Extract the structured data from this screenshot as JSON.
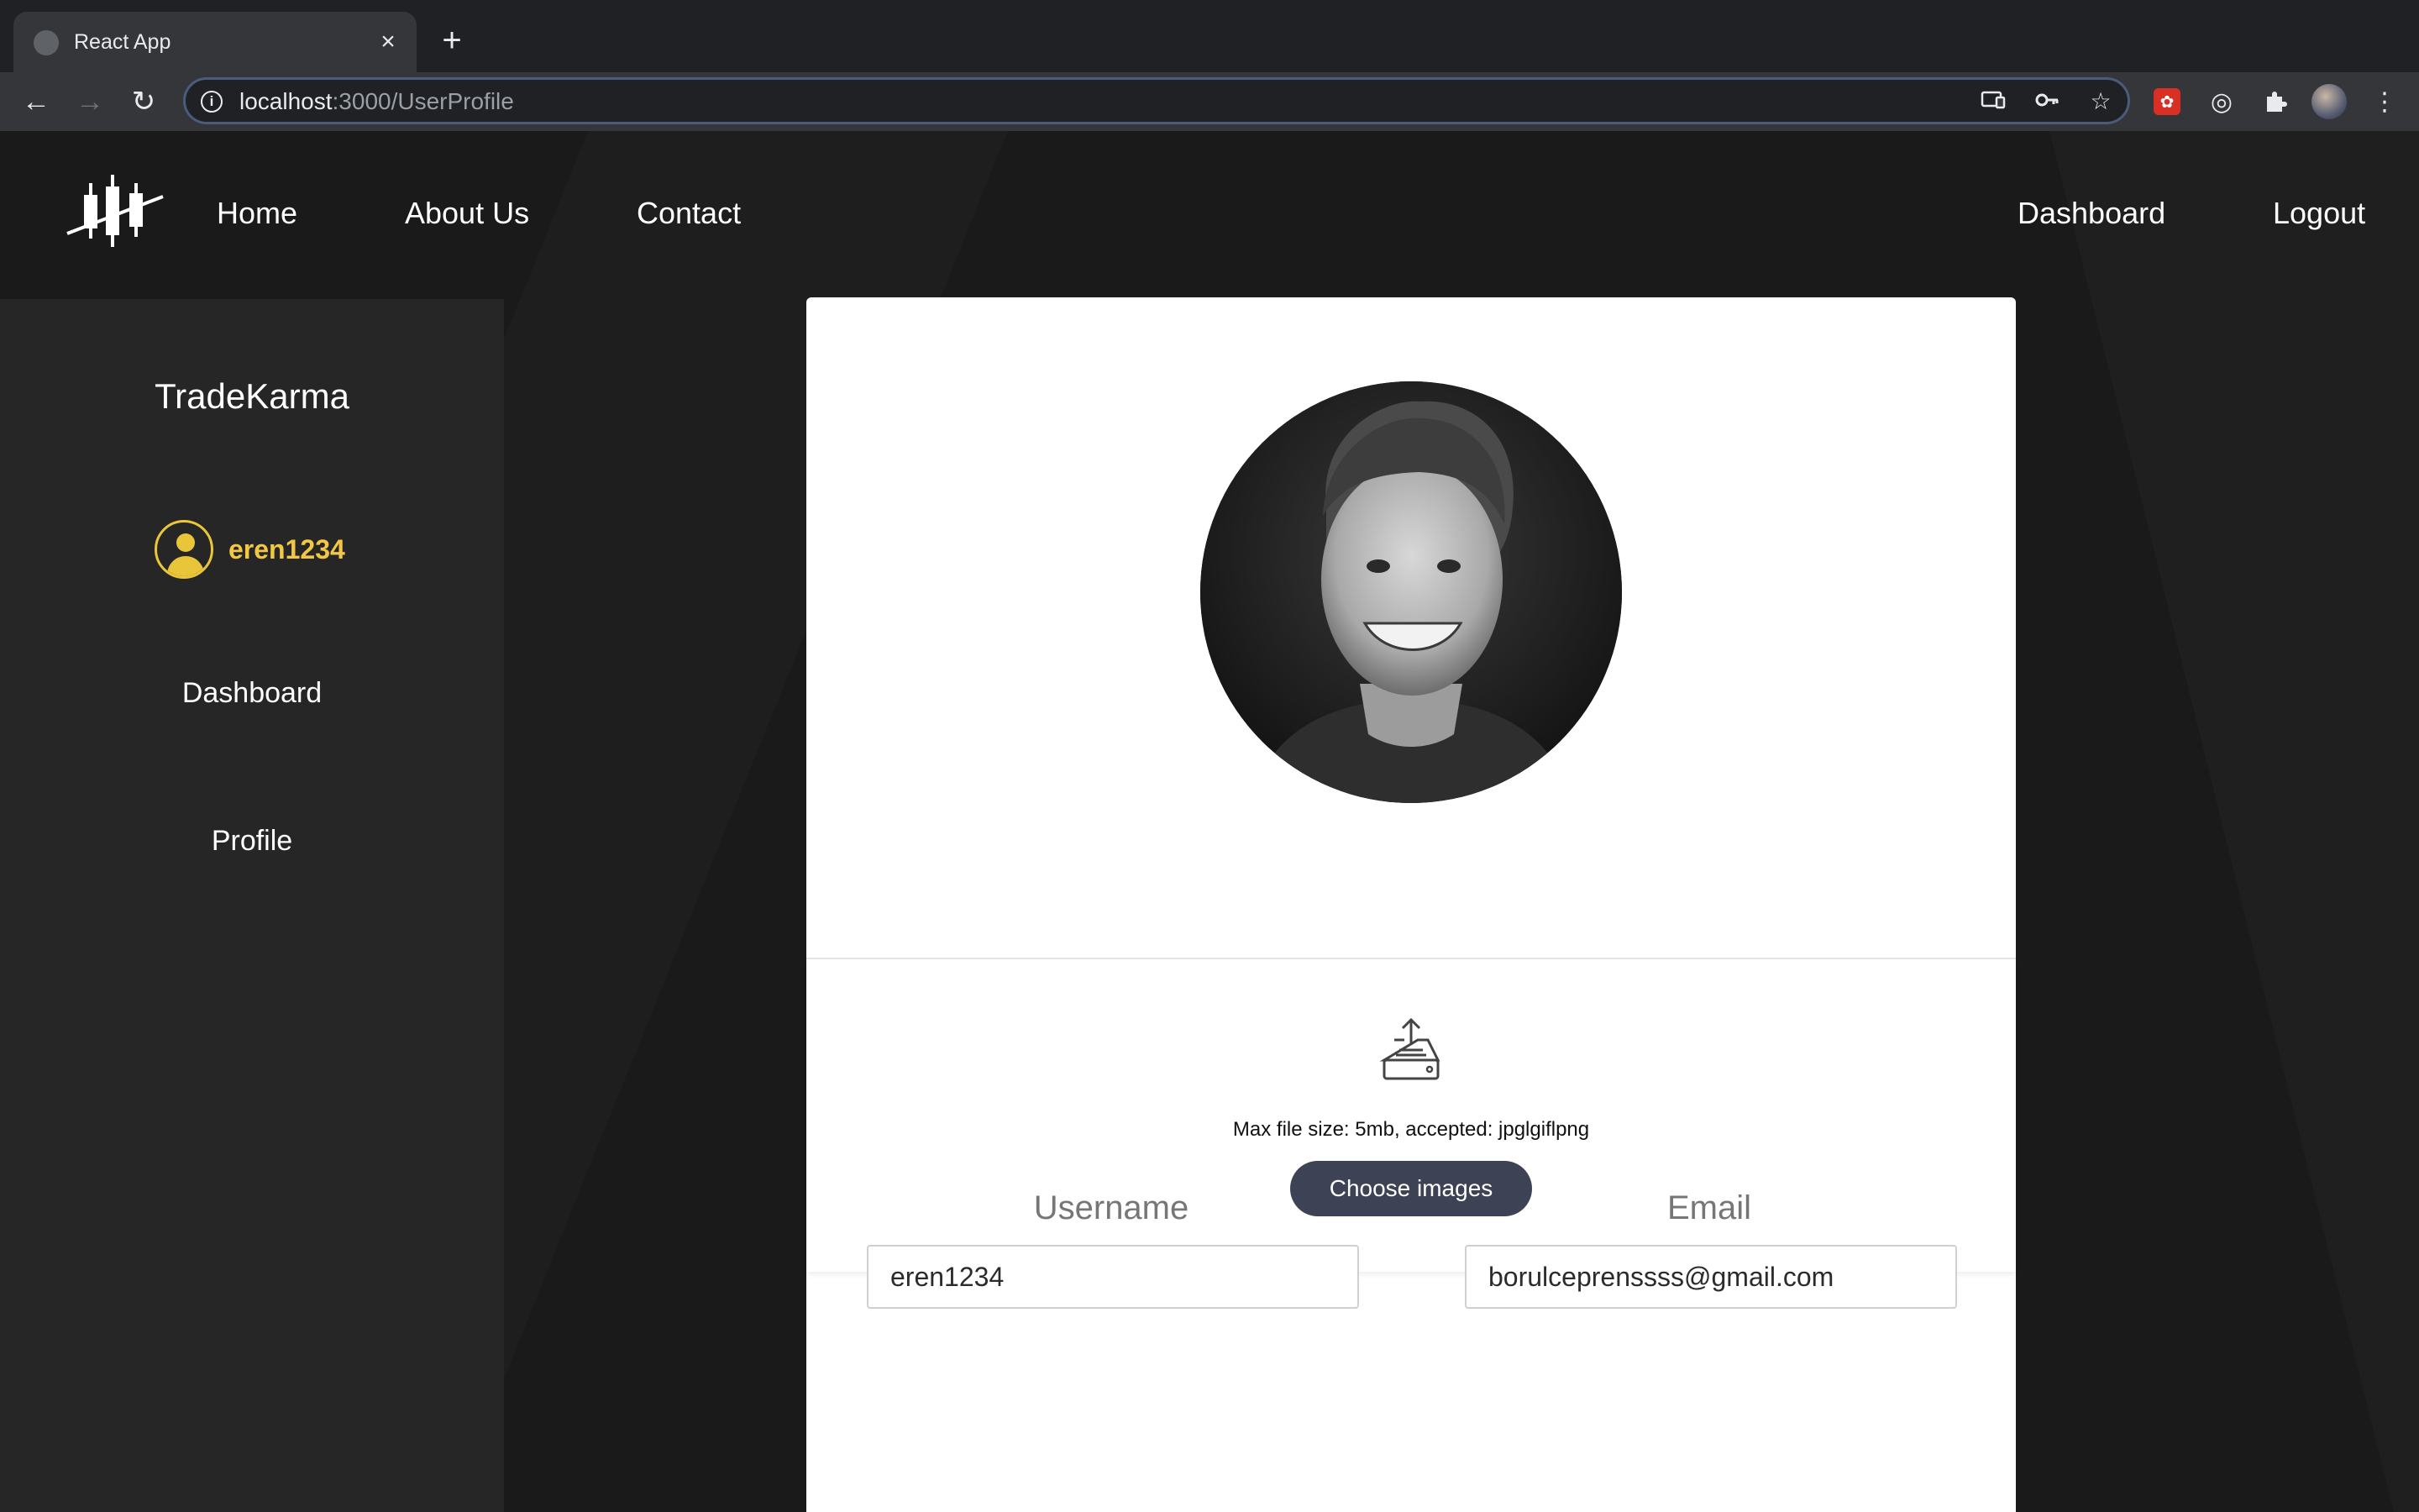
{
  "browser": {
    "tab_title": "React App",
    "tab_close": "×",
    "new_tab": "+",
    "url_host": "localhost",
    "url_path": ":3000/UserProfile",
    "extensions": [
      "cast-icon",
      "key-icon",
      "star-icon",
      "red-extension-icon",
      "target-extension-icon",
      "puzzle-icon",
      "profile-avatar",
      "kebab-menu-icon"
    ]
  },
  "navbar": {
    "links_left": [
      "Home",
      "About Us",
      "Contact"
    ],
    "links_right": [
      "Dashboard",
      "Logout"
    ]
  },
  "sidebar": {
    "brand": "TradeKarma",
    "username": "eren1234",
    "items": [
      "Dashboard",
      "Profile"
    ]
  },
  "profile": {
    "upload_hint": "Max file size: 5mb, accepted: jpglgiflpng",
    "choose_button": "Choose images",
    "username_label": "Username",
    "username_value": "eren1234",
    "email_label": "Email",
    "email_value": "borulceprenssss@gmail.com"
  },
  "colors": {
    "accent_gold": "#f2c744",
    "button_bg": "#3e4255",
    "page_bg": "#1a1a1a",
    "sidebar_bg": "#262626"
  }
}
